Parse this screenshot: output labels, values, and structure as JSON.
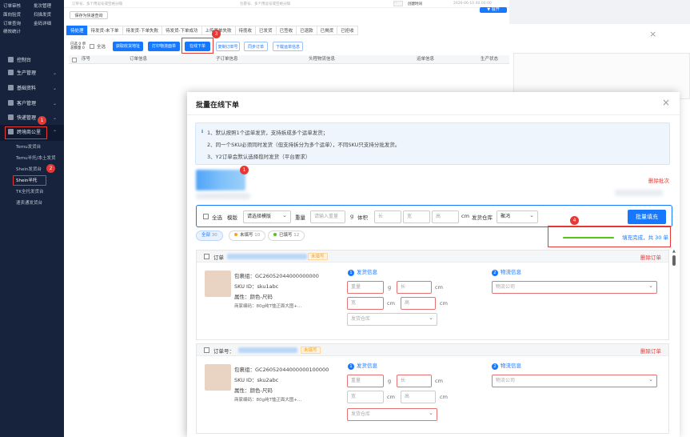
{
  "sidebar": {
    "top_items": [
      "订单审核",
      "批次管理",
      "面向验货",
      "扫描发货",
      "订单查询",
      "金码详细",
      "绩效统计"
    ],
    "menus": [
      {
        "label": "控制台",
        "expandable": false
      },
      {
        "label": "生产管理",
        "expandable": true
      },
      {
        "label": "基础资料",
        "expandable": true
      },
      {
        "label": "客户管理",
        "expandable": true
      },
      {
        "label": "快递管理",
        "expandable": true
      },
      {
        "label": "跨境商公里",
        "expandable": true
      }
    ],
    "subs": [
      "Temu发货台",
      "Temu半托/本土发货",
      "Shein发货台",
      "Shein半托",
      "TK全托发货台",
      "速卖通发货台"
    ],
    "badges": {
      "b1": "1",
      "b2": "2"
    }
  },
  "background": {
    "search_placeholders": [
      "订单号、多个用逗号或空格分隔",
      "包裹号、多个用逗号或空格分隔",
      "创建时间",
      "2026-06-10 00:00:00"
    ],
    "save_quick": "保存为快速查询",
    "filter_btn": "▼ 展开",
    "tabs": [
      "待处理",
      "待发货-未下单",
      "待发货-下单失败",
      "待发货-下单成功",
      "上传面单失败",
      "待揽收",
      "已发货",
      "已签收",
      "已退款",
      "已揭货",
      "已拒收"
    ],
    "select_label": "已选 0 单",
    "total_label": "总数量 0",
    "select_all": "全选",
    "buttons": [
      "获取收货地址",
      "打印物流面单",
      "在线下单",
      "复制订单号",
      "同步订单",
      "下载运单信息"
    ],
    "table_headers": [
      "序号",
      "订单信息",
      "子订单信息",
      "头程物流信息",
      "运单信息",
      "生产状态"
    ],
    "badge3": "3"
  },
  "modal": {
    "title": "批量在线下单",
    "close": "×",
    "notices": [
      "1、默认按照1个运单发货，支持拆成多个运单发货；",
      "2、同一个SKU必须同时发货（但支持拆分为多个运单），不同SKU只支持分批发货。",
      "3、Y2订单会默认选择揽时发货（平台要求）"
    ],
    "batch_badge": "1",
    "delete_batch": "删除批次",
    "bulk": {
      "select_all": "全选",
      "template_label": "模版",
      "template_value": "请选择模版",
      "weight_label": "重量",
      "weight_placeholder": "请输入重量",
      "weight_unit": "g",
      "volume_label": "体积",
      "len_ph": "长",
      "wid_ph": "宽",
      "hei_ph": "高",
      "cm": "cm",
      "warehouse_label": "发货仓库",
      "warehouse_value": "聚鸿",
      "fill_btn": "批量填充"
    },
    "filters": [
      {
        "label": "全部",
        "count": "30",
        "dot": ""
      },
      {
        "label": "未填写",
        "count": "10",
        "dot": "#f5a623"
      },
      {
        "label": "已填写",
        "count": "12",
        "dot": "#52c41a"
      }
    ],
    "progress": {
      "badge": "4",
      "text": "填充完成，共 30 单",
      "value": 1.0
    },
    "orders": [
      {
        "order_label": "订单",
        "status": "未填写",
        "delete": "删除订单",
        "package": "包裹组：GC26052044000000000",
        "sku": "SKU ID：sku1abc",
        "attr_label": "属性：",
        "attr_value": "颜色-尺码",
        "merchant": "商家编码：80g纯T恤正面大图+...",
        "ship_title": "发货信息",
        "logistics_title": "物流信息",
        "weight_ph": "重量",
        "len_ph": "长",
        "wid_ph": "宽",
        "hei_ph": "高",
        "g": "g",
        "cm": "cm",
        "warehouse_ph": "发货仓库",
        "logistics_ph": "物流公司"
      },
      {
        "order_label": "订单号：",
        "status": "未填写",
        "delete": "删除订单",
        "package": "包裹组：GC26052044000000100000",
        "sku": "SKU ID：sku2abc",
        "attr_label": "属性：",
        "attr_value": "颜色-尺码",
        "merchant": "商家编码：80g纯T恤正面大图+...",
        "ship_title": "发货信息",
        "logistics_title": "物流信息",
        "weight_ph": "重量",
        "len_ph": "长",
        "wid_ph": "宽",
        "hei_ph": "高",
        "g": "g",
        "cm": "cm",
        "warehouse_ph": "发货仓库",
        "logistics_ph": "物流公司"
      }
    ]
  },
  "colors": {
    "primary": "#1677ff",
    "danger": "#e53935",
    "success": "#52c41a",
    "sidebar": "#17233d"
  }
}
